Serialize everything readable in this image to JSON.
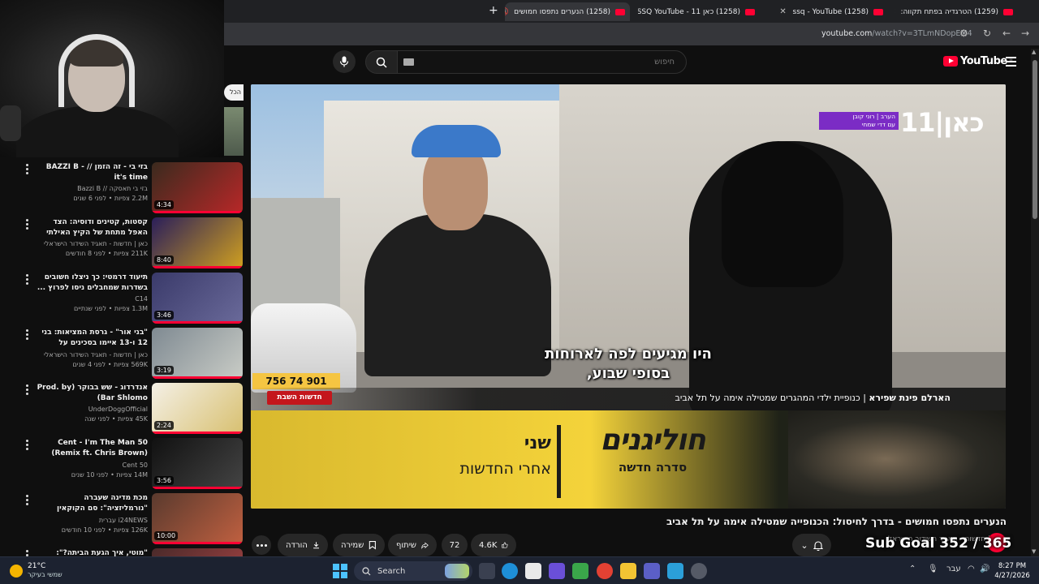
{
  "browser": {
    "tabs": [
      {
        "label": "(1258) הנערים נתפסו חמושים",
        "active": true
      },
      {
        "label": "(1258) כאן 11 - SSQ YouTube",
        "active": false
      },
      {
        "label": "(1258) ssq - YouTube",
        "active": false
      },
      {
        "label": "(1259) הטרגדיה בפתח תקווה:",
        "active": false
      }
    ],
    "url_host": "youtube.com",
    "url_path": "/watch?v=3TLmNDopEM4"
  },
  "header": {
    "search_placeholder": "חיפוש",
    "logo_text": "YouTube",
    "logo_region": "IL"
  },
  "sidebar": {
    "top_chip": "הכל",
    "items": [
      {
        "title": "בזי בי - זה הזמן // BAZZI B - it's time",
        "channel": "בזי בי תאסקה // Bazzi B",
        "meta": "2.2M צפיות • לפני 6 שנים",
        "duration": "4:34",
        "thumb": "#3a2a1e",
        "thumb2": "#b82828"
      },
      {
        "title": "קסטות, קטינים ודוסיה: הצד האפל מתחת של הקיץ האילתי",
        "channel": "כאן | חדשות - תאגיד השידור הישראלי",
        "meta": "211K צפיות • לפני 8 חודשים",
        "duration": "8:40",
        "thumb": "#2a1e5a",
        "thumb2": "#d0a020"
      },
      {
        "title": "תיעוד דרמטי: כך ניצלו חשובים בשדרות שמחבלים ניסו לפרוץ ...",
        "channel": "C14",
        "meta": "1.3M צפיות • לפני שנתיים",
        "duration": "3:46",
        "thumb": "#3a3a6a",
        "thumb2": "#6a6a9a"
      },
      {
        "title": "\"בני אור\" - גרסת המציאות: בני 12 ו-13 איימו בסכינים על סטודנטים ...",
        "channel": "כאן | חדשות - תאגיד השידור הישראלי",
        "meta": "569K צפיות • לפני 4 שנים",
        "duration": "3:19",
        "thumb": "#7f8a92",
        "thumb2": "#c9ccc6"
      },
      {
        "title": "אנדרדוג - שש בבוקר (Prod. by Bar Shlomo)",
        "channel": "UnderDoggOfficial",
        "meta": "45K צפיות • לפני שנה",
        "duration": "2:24",
        "thumb": "#f4f0e6",
        "thumb2": "#d8c070"
      },
      {
        "title": "50 Cent - I'm The Man (Remix ft. Chris Brown) [CDQ / Dirty]",
        "channel": "50 Cent",
        "meta": "14M צפיות • לפני 10 שנים",
        "duration": "3:56",
        "thumb": "#111111",
        "thumb2": "#444444"
      },
      {
        "title": "מכת מדינה שעברה \"נורמליזציה\": סם הקוקאין נמצא בכל מקום - האם המ...",
        "channel": "i24NEWS עברית",
        "meta": "126K צפיות • לפני 10 חודשים",
        "duration": "10:00",
        "thumb": "#5a3a2e",
        "thumb2": "#c06040"
      },
      {
        "title": "\"מוטי, איך הגעת הביתה?\": משפחות",
        "channel": "",
        "meta": "",
        "duration": "",
        "thumb": "#4a2a2a",
        "thumb2": "#aa4444"
      }
    ]
  },
  "player": {
    "subtitle_line1": "היו מגיעים לפה לארוחות",
    "subtitle_line2": "בסופי שבוע,",
    "lower_third_bold": "הארלם פינת שפירא",
    "lower_third_text": "כנופיית ילדי המהגרים שמטילה אימה על תל אביב",
    "news_tag": "חדשות השבת",
    "plate": "756 74 901",
    "kan_logo": "כאן|11",
    "kan_badge_line1": "הערב | רוני קובן",
    "kan_badge_line2": "עם דדי שמחי",
    "promo_line1": "שני",
    "promo_line2": "אחרי החדשות",
    "promo_show": "חוליגנים",
    "promo_season": "סדרה חדשה"
  },
  "video": {
    "title": "הנערים נתפסו חמושים - בדרך לחיסול: הכנופייה שמטילה אימה על תל אביב",
    "channel": "כאן | חדשות - תאגיד השידור הישראלי",
    "actions": {
      "like_count": "4.6K",
      "comments_count": "72",
      "share_label": "שיתוף",
      "save_label": "שמירה",
      "download_label": "הורדה"
    },
    "sub_goal": "Sub Goal 352 / 365"
  },
  "taskbar": {
    "temperature": "21°C",
    "weather": "שמשי בעיקר",
    "search_label": "Search",
    "lang": "עבר",
    "time": "8:27 PM",
    "date": "4/27/2026"
  },
  "colors": {
    "youtube_red": "#ff0033",
    "background": "#0f0f0f",
    "chip": "#272727"
  }
}
